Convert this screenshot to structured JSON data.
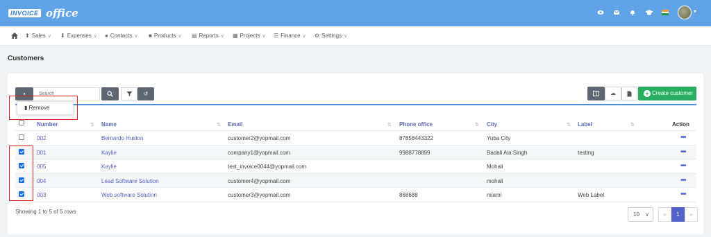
{
  "app": {
    "logo_brand": "INVOICE",
    "logo_suffix": "office",
    "top_icons": [
      "eye-icon",
      "mail-icon",
      "bell-icon",
      "graduation-cap-icon",
      "india-flag-icon"
    ]
  },
  "menu": {
    "items": [
      {
        "label": "Sales",
        "icon": "sales-icon"
      },
      {
        "label": "Expenses",
        "icon": "expenses-icon"
      },
      {
        "label": "Contacts",
        "icon": "contacts-icon"
      },
      {
        "label": "Products",
        "icon": "products-icon"
      },
      {
        "label": "Reports",
        "icon": "reports-icon"
      },
      {
        "label": "Projects",
        "icon": "projects-icon"
      },
      {
        "label": "Finance",
        "icon": "finance-icon"
      },
      {
        "label": "Settings",
        "icon": "settings-icon"
      }
    ]
  },
  "page": {
    "title": "Customers"
  },
  "toolbar": {
    "search_placeholder": "Search",
    "remove_label": "Remove",
    "create_label": "Create customer"
  },
  "table": {
    "columns": [
      "Number",
      "Name",
      "Email",
      "Phone office",
      "City",
      "Label",
      "Action"
    ],
    "rows": [
      {
        "checked": false,
        "number": "002",
        "name": "Bernardo Huston",
        "email": "customer2@yopmail.com",
        "phone": "87856443322",
        "city": "Yuba City",
        "label": ""
      },
      {
        "checked": true,
        "number": "001",
        "name": "Kaylie",
        "email": "company1@yopmail.com",
        "phone": "9988778899",
        "city": "Badali Ala Singh",
        "label": "testing"
      },
      {
        "checked": true,
        "number": "005",
        "name": "Kaylie",
        "email": "test_invoice0044@yopmail.com",
        "phone": "",
        "city": "Mohali",
        "label": ""
      },
      {
        "checked": true,
        "number": "004",
        "name": "Lead Software Solution",
        "email": "customer4@yopmail.com",
        "phone": "",
        "city": "mohali",
        "label": ""
      },
      {
        "checked": true,
        "number": "003",
        "name": "Web software Solution",
        "email": "customer3@yopmail.com",
        "phone": "868688",
        "city": "miami",
        "label": "Web Label"
      }
    ],
    "action_glyph": "•••"
  },
  "footer": {
    "showing": "Showing 1 to 5 of 5 rows",
    "page_size": "10",
    "prev": "«",
    "current_page": "1",
    "next": "»"
  },
  "colors": {
    "topbar": "#5fa3e6",
    "accent": "#5461c8",
    "create": "#27ae60",
    "annotation": "#e01e1e"
  }
}
